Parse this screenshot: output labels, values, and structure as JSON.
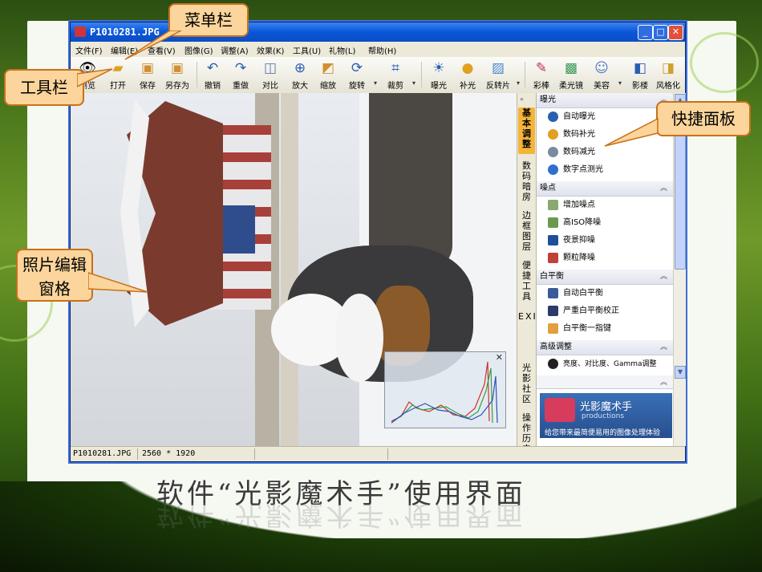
{
  "window": {
    "title": "P1010281.JPG",
    "controls": {
      "minimize": "_",
      "maximize": "□",
      "close": "✕"
    }
  },
  "menubar": {
    "items": [
      "文件(F)",
      "编辑(E)",
      "查看(V)",
      "图像(G)",
      "调整(A)",
      "效果(K)",
      "工具(U)",
      "礼物(L)",
      "帮助(H)"
    ]
  },
  "toolbar": {
    "buttons": [
      {
        "label": "浏览",
        "icon": "eye-icon"
      },
      {
        "label": "打开",
        "icon": "folder-open-icon"
      },
      {
        "label": "保存",
        "icon": "save-icon"
      },
      {
        "label": "另存为",
        "icon": "save-as-icon"
      },
      {
        "label": "撤销",
        "icon": "undo-icon"
      },
      {
        "label": "重做",
        "icon": "redo-icon"
      },
      {
        "label": "对比",
        "icon": "compare-icon"
      },
      {
        "label": "放大",
        "icon": "zoom-in-icon"
      },
      {
        "label": "缩放",
        "icon": "resize-icon"
      },
      {
        "label": "旋转",
        "icon": "rotate-icon"
      },
      {
        "label": "裁剪",
        "icon": "crop-icon"
      },
      {
        "label": "曝光",
        "icon": "sun-icon"
      },
      {
        "label": "补光",
        "icon": "fill-light-icon"
      },
      {
        "label": "反转片",
        "icon": "slide-film-icon"
      },
      {
        "label": "彩棒",
        "icon": "color-stick-icon"
      },
      {
        "label": "柔光镜",
        "icon": "soft-light-icon"
      },
      {
        "label": "美容",
        "icon": "beauty-icon"
      },
      {
        "label": "影楼",
        "icon": "studio-icon"
      },
      {
        "label": "风格化",
        "icon": "stylize-icon"
      }
    ]
  },
  "side_tabs": [
    {
      "label": "基本调整",
      "active": true
    },
    {
      "label": "数码暗房",
      "active": false
    },
    {
      "label": "边框图层",
      "active": false
    },
    {
      "label": "便捷工具",
      "active": false
    },
    {
      "label": "EXIF",
      "active": false
    },
    {
      "label": "光影社区",
      "active": false
    },
    {
      "label": "操作历史",
      "active": false
    }
  ],
  "panel": {
    "collapse_glyph": "«",
    "sections": [
      {
        "title": "曝光",
        "items": [
          {
            "label": "自动曝光",
            "icon": "sun-icon",
            "color": "#2a5fb0"
          },
          {
            "label": "数码补光",
            "icon": "bulb-icon",
            "color": "#e0a020"
          },
          {
            "label": "数码减光",
            "icon": "dim-bulb-icon",
            "color": "#7a8aa0"
          },
          {
            "label": "数字点测光",
            "icon": "meter-icon",
            "color": "#2f6fd0"
          }
        ]
      },
      {
        "title": "噪点",
        "items": [
          {
            "label": "增加噪点",
            "icon": "noise-add-icon",
            "color": "#8aa870"
          },
          {
            "label": "高ISO降噪",
            "icon": "iso-icon",
            "color": "#6a9a50"
          },
          {
            "label": "夜景抑噪",
            "icon": "night-icon",
            "color": "#1f4f9a"
          },
          {
            "label": "颗粒降噪",
            "icon": "grain-icon",
            "color": "#c0403a"
          }
        ]
      },
      {
        "title": "白平衡",
        "items": [
          {
            "label": "自动白平衡",
            "icon": "wb-auto-icon",
            "color": "#3a5a9a"
          },
          {
            "label": "严重白平衡校正",
            "icon": "wb-correct-icon",
            "color": "#2a3a6a"
          },
          {
            "label": "白平衡一指键",
            "icon": "wb-finger-icon",
            "color": "#e0a040"
          }
        ]
      },
      {
        "title": "高级调整",
        "items": [
          {
            "label": "亮度、对比度、Gamma调整",
            "icon": "contrast-icon",
            "color": "#222222"
          }
        ]
      }
    ],
    "brand": {
      "name": "光影魔术手",
      "sub": "productions",
      "tagline": "给您带来最简便易用的图像处理体验"
    }
  },
  "statusbar": {
    "filename": "P1010281.JPG",
    "dimensions": "2560 * 1920"
  },
  "callouts": {
    "menubar": "菜单栏",
    "toolbar": "工具栏",
    "quick_panel": "快捷面板",
    "photo_pane": "照片编辑窗格"
  },
  "caption": "软件“光影魔术手”使用界面",
  "colors": {
    "accent": "#f4b43a",
    "titlebar": "#0a56d8",
    "callout_fill": "#fbd59b",
    "callout_border": "#c7711a"
  }
}
